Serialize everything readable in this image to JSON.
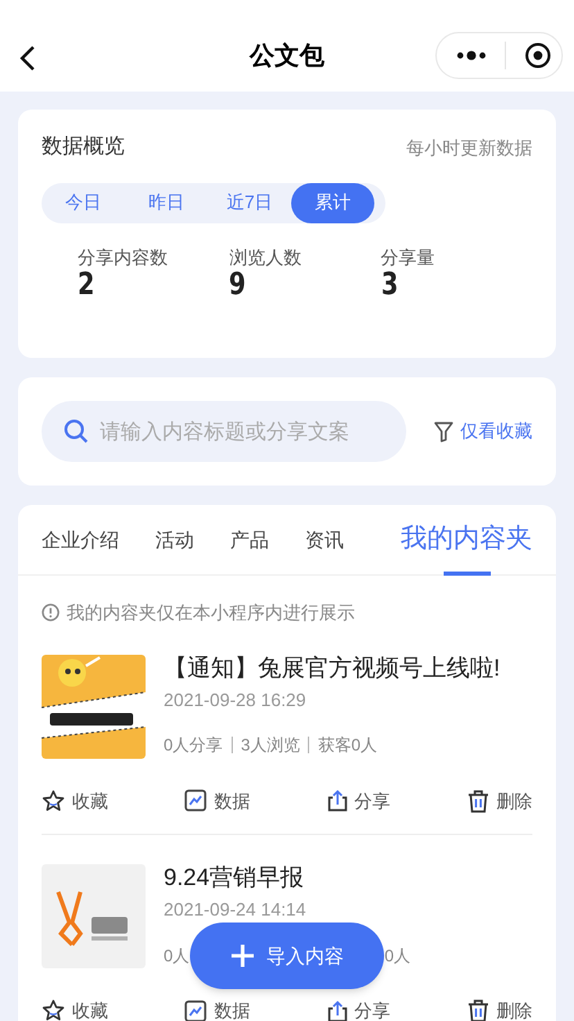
{
  "nav": {
    "title": "公文包"
  },
  "overview": {
    "title": "数据概览",
    "note": "每小时更新数据",
    "periods": [
      {
        "label": "今日",
        "selected": false
      },
      {
        "label": "昨日",
        "selected": false
      },
      {
        "label": "近7日",
        "selected": false
      },
      {
        "label": "累计",
        "selected": true
      }
    ],
    "stats": [
      {
        "label": "分享内容数",
        "value": "2"
      },
      {
        "label": "浏览人数",
        "value": "9"
      },
      {
        "label": "分享量",
        "value": "3"
      }
    ]
  },
  "search": {
    "placeholder": "请输入内容标题或分享文案",
    "filter": "仅看收藏"
  },
  "tabs": [
    {
      "label": "企业介绍",
      "selected": false
    },
    {
      "label": "活动",
      "selected": false
    },
    {
      "label": "产品",
      "selected": false
    },
    {
      "label": "资讯",
      "selected": false
    },
    {
      "label": "我的内容夹",
      "selected": true
    }
  ],
  "notice": "我的内容夹仅在本小程序内进行展示",
  "items": [
    {
      "kind": "full",
      "title": "【通知】兔展官方视频号上线啦!",
      "date": "2021-09-28 16:29",
      "stats": [
        "0人分享",
        "3人浏览",
        "获客0人"
      ],
      "actions": [
        "收藏",
        "数据",
        "分享",
        "删除"
      ]
    },
    {
      "kind": "covered",
      "title": "9.24营销早报",
      "date": "2021-09-24 14:14",
      "stats": [
        "0人",
        "0人"
      ],
      "actions": [
        "收藏",
        "数据",
        "分享",
        "删除"
      ]
    }
  ],
  "fab": {
    "label": "导入内容"
  }
}
